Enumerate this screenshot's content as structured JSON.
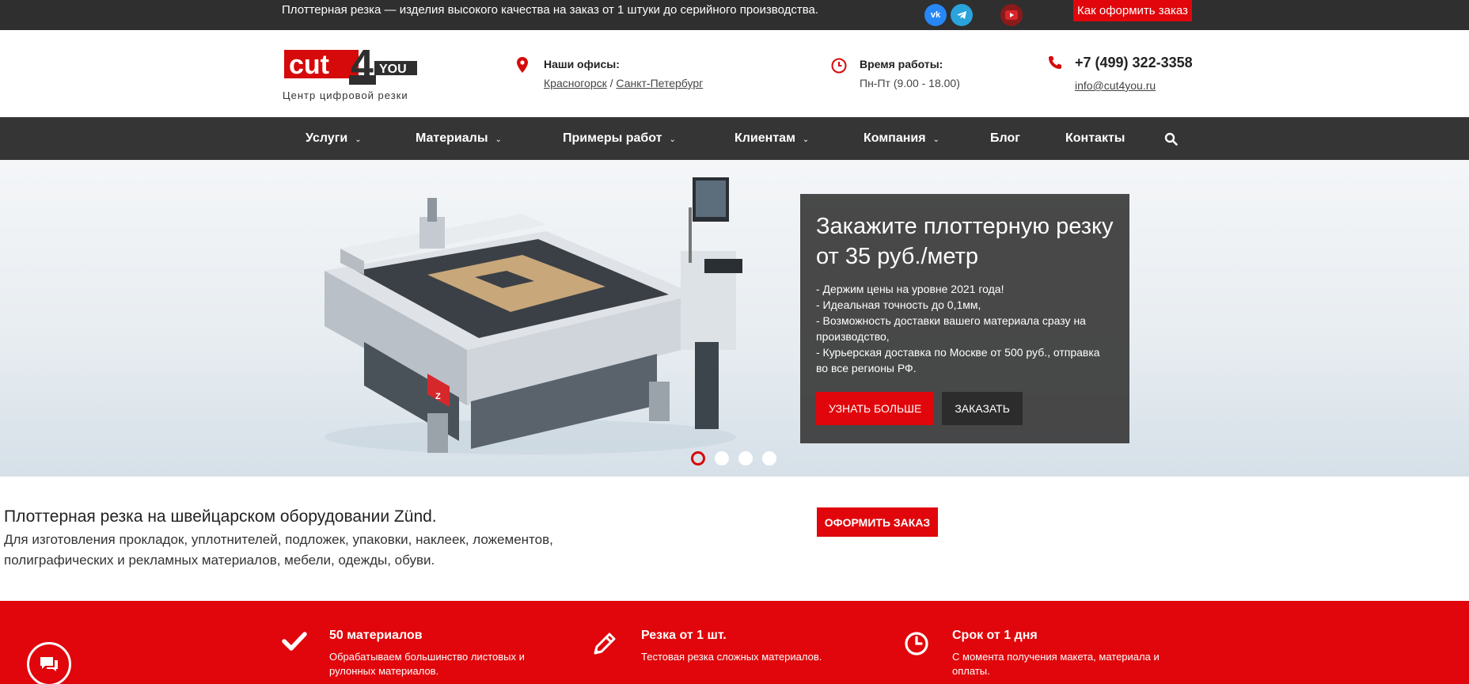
{
  "topbar": {
    "tagline": "Плоттерная резка — изделия высокого качества на заказ от 1 штуки до серийного производства.",
    "social": [
      "vk-icon",
      "telegram-icon",
      "youtube-icon"
    ],
    "order_link": "Как оформить заказ"
  },
  "header": {
    "logo_text": "cut4you",
    "logo_sub": "Центр цифровой резки",
    "offices_title": "Наши офисы:",
    "office_1": "Красногорск",
    "office_sep": " / ",
    "office_2": "Санкт-Петербург",
    "hours_title": "Время работы:",
    "hours": "Пн-Пт (9.00 - 18.00)",
    "phone": "+7 (499) 322-3358",
    "email": "info@cut4you.ru"
  },
  "nav": {
    "items": [
      {
        "label": "Услуги",
        "dropdown": true
      },
      {
        "label": "Материалы",
        "dropdown": true
      },
      {
        "label": "Примеры работ",
        "dropdown": true
      },
      {
        "label": "Клиентам",
        "dropdown": true
      },
      {
        "label": "Компания",
        "dropdown": true
      },
      {
        "label": "Блог",
        "dropdown": false
      },
      {
        "label": "Контакты",
        "dropdown": false
      }
    ],
    "search_icon": "search-icon"
  },
  "hero": {
    "title": "Закажите плоттерную резку от 35 руб./метр",
    "bullets": [
      "- Держим цены на уровне 2021 года!",
      "- Идеальная точность до 0,1мм,",
      "- Возможность доставки вашего материала сразу на производство,",
      "- Курьерская доставка по Москве от 500 руб., отправка во все регионы РФ."
    ],
    "btn_more": "УЗНАТЬ БОЛЬШЕ",
    "btn_order": "ЗАКАЗАТЬ",
    "slides": 4,
    "active_slide": 1
  },
  "intro": {
    "title": "Плоттерная резка на швейцарском оборудовании Zünd.",
    "text": "Для изготовления прокладок, уплотнителей, подложек, упаковки, наклеек, ложементов, полиграфических и рекламных материалов, мебели, одежды, обуви.",
    "order_button": "ОФОРМИТЬ ЗАКАЗ"
  },
  "features": [
    {
      "icon": "checkmark-icon",
      "title": "50 материалов",
      "text": "Обрабатываем большинство листовых и рулонных материалов."
    },
    {
      "icon": "pencil-icon",
      "title": "Резка от 1 шт.",
      "text": "Тестовая резка сложных материалов."
    },
    {
      "icon": "clock-icon",
      "title": "Срок от 1 дня",
      "text": "С момента получения макета, материала и оплаты."
    }
  ],
  "colors": {
    "accent": "#e0060b",
    "dark": "#353535",
    "topbar": "#2f2f2f"
  }
}
